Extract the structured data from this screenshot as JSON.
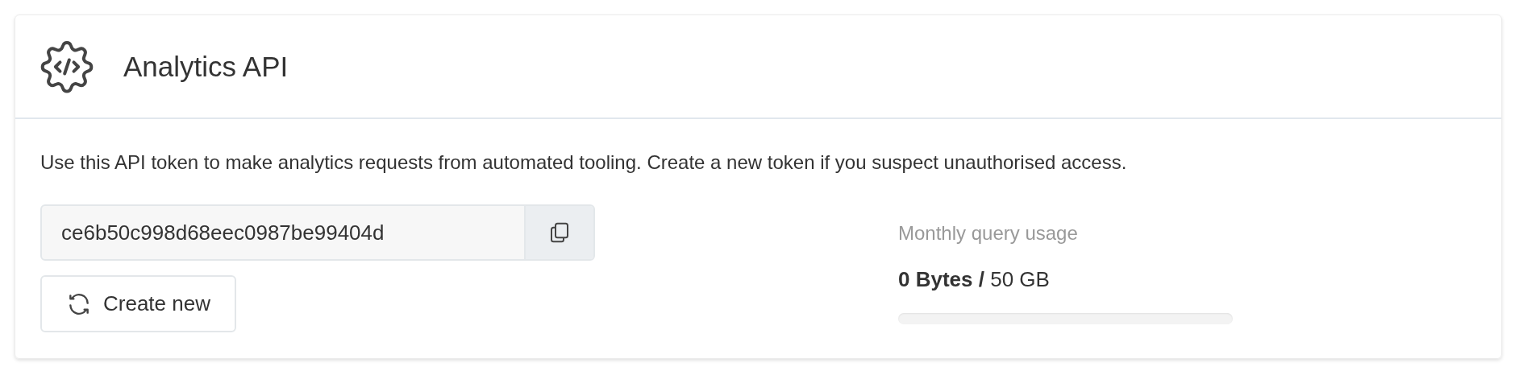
{
  "card": {
    "title": "Analytics API",
    "description": "Use this API token to make analytics requests from automated tooling. Create a new token if you suspect unauthorised access.",
    "token": {
      "value": "ce6b50c998d68eec0987be99404d"
    },
    "create_button": {
      "label": "Create new"
    },
    "usage": {
      "label": "Monthly query usage",
      "reading": "**0 Bytes /** 50 GB",
      "level": 0
    }
  }
}
